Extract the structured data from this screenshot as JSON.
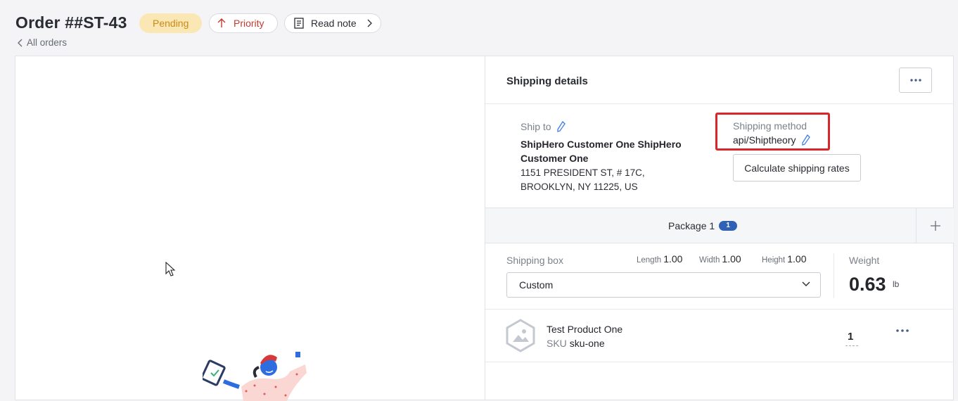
{
  "header": {
    "order_title": "Order ##ST-43",
    "status_badge": "Pending",
    "priority_label": "Priority",
    "note_label": "Read note",
    "back_link": "All orders"
  },
  "shipping": {
    "title": "Shipping details",
    "ship_to_label": "Ship to",
    "ship_to_name": "ShipHero Customer One ShipHero Customer One",
    "address_line1": "1151 PRESIDENT ST, # 17C,",
    "address_line2": "BROOKLYN, NY 11225, US",
    "method_label": "Shipping method",
    "method_value": "api/Shiptheory",
    "calc_button": "Calculate shipping rates"
  },
  "package": {
    "label": "Package 1",
    "count": "1",
    "box_label": "Shipping box",
    "length_label": "Length",
    "length_value": "1.00",
    "width_label": "Width",
    "width_value": "1.00",
    "height_label": "Height",
    "height_value": "1.00",
    "box_selected": "Custom",
    "weight_label": "Weight",
    "weight_value": "0.63",
    "weight_unit": "lb"
  },
  "product": {
    "name": "Test Product One",
    "sku_label": "SKU",
    "sku_value": "sku-one",
    "quantity": "1"
  },
  "colors": {
    "accent_blue": "#2f62b6",
    "priority_red": "#c23b31",
    "highlight_red": "#d9262b",
    "pending_bg": "#fbe7b4"
  }
}
